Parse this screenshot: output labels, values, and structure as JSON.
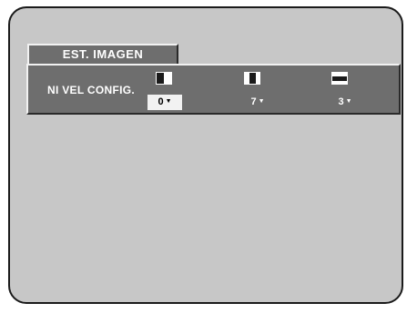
{
  "menu": {
    "tab_label": "EST.  IMAGEN",
    "row_label": "NI VEL CONFIG.",
    "options": [
      {
        "icon": "contrast-half-icon",
        "value": "0",
        "arrow": "▼",
        "selected": true
      },
      {
        "icon": "contrast-center-icon",
        "value": "7",
        "arrow": "▼",
        "selected": false
      },
      {
        "icon": "contrast-band-icon",
        "value": "3",
        "arrow": "▼",
        "selected": false
      }
    ]
  },
  "colors": {
    "screen_bg": "#c7c7c7",
    "panel_bg": "#6e6e6e",
    "highlight_bg": "#f2f2f2",
    "text": "#ffffff"
  }
}
